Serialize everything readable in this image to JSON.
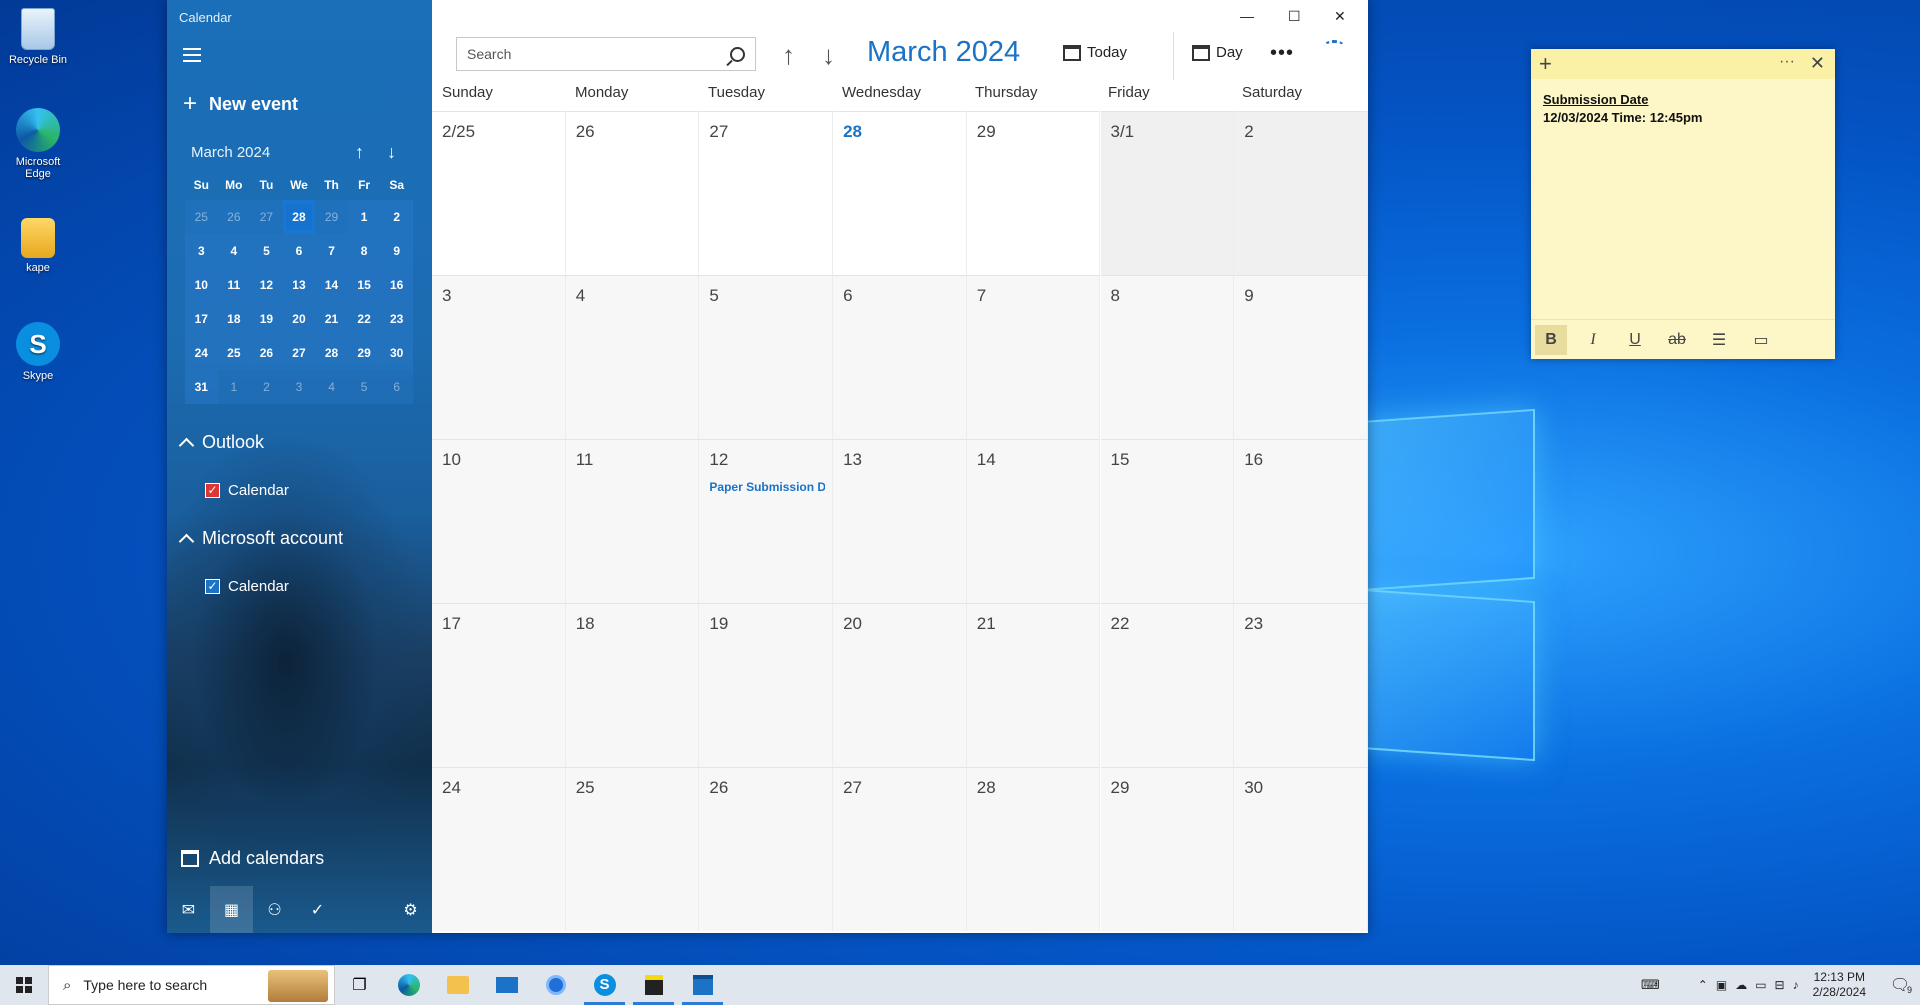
{
  "desktop": {
    "icons": [
      {
        "label": "Recycle Bin"
      },
      {
        "label": "Microsoft Edge"
      },
      {
        "label": "kape"
      },
      {
        "label": "Skype"
      }
    ]
  },
  "calendar": {
    "app_title": "Calendar",
    "new_event": "New event",
    "mini": {
      "month": "March 2024",
      "weekdays": [
        "Su",
        "Mo",
        "Tu",
        "We",
        "Th",
        "Fr",
        "Sa"
      ],
      "weeks": [
        [
          "25",
          "26",
          "27",
          "28",
          "29",
          "1",
          "2"
        ],
        [
          "3",
          "4",
          "5",
          "6",
          "7",
          "8",
          "9"
        ],
        [
          "10",
          "11",
          "12",
          "13",
          "14",
          "15",
          "16"
        ],
        [
          "17",
          "18",
          "19",
          "20",
          "21",
          "22",
          "23"
        ],
        [
          "24",
          "25",
          "26",
          "27",
          "28",
          "29",
          "30"
        ],
        [
          "31",
          "1",
          "2",
          "3",
          "4",
          "5",
          "6"
        ]
      ]
    },
    "groups": [
      {
        "name": "Outlook",
        "calendar": "Calendar",
        "color": "#e03535"
      },
      {
        "name": "Microsoft account",
        "calendar": "Calendar",
        "color": "#1a73c7"
      }
    ],
    "add_calendars": "Add calendars",
    "toolbar": {
      "search_placeholder": "Search",
      "month_title": "March 2024",
      "today": "Today",
      "view": "Day"
    },
    "days": [
      "Sunday",
      "Monday",
      "Tuesday",
      "Wednesday",
      "Thursday",
      "Friday",
      "Saturday"
    ],
    "weeks": [
      [
        "2/25",
        "26",
        "27",
        "28",
        "29",
        "3/1",
        "2"
      ],
      [
        "3",
        "4",
        "5",
        "6",
        "7",
        "8",
        "9"
      ],
      [
        "10",
        "11",
        "12",
        "13",
        "14",
        "15",
        "16"
      ],
      [
        "17",
        "18",
        "19",
        "20",
        "21",
        "22",
        "23"
      ],
      [
        "24",
        "25",
        "26",
        "27",
        "28",
        "29",
        "30"
      ]
    ],
    "event": {
      "text": "Paper Submission D",
      "week": 2,
      "day": 2
    }
  },
  "sticky": {
    "title": "Submission Date",
    "body": "12/03/2024 Time: 12:45pm",
    "tools": [
      "B",
      "I",
      "U",
      "ab"
    ]
  },
  "taskbar": {
    "search_placeholder": "Type here to search",
    "time": "12:13 PM",
    "date": "2/28/2024",
    "notif_count": "9"
  }
}
